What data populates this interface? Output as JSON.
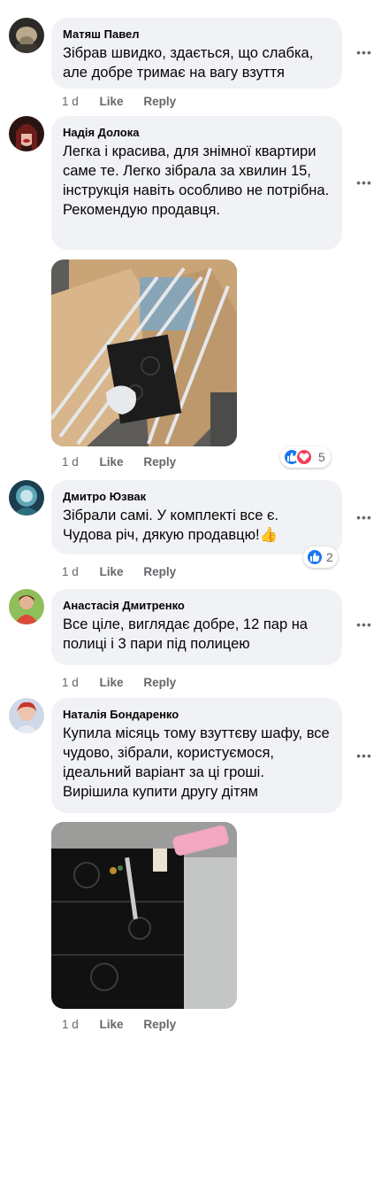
{
  "comments": [
    {
      "name": "Матяш Павел",
      "text": "Зібрав швидко, здається, що слабка, але добре тримає на вагу взуття",
      "time": "1 d",
      "like": "Like",
      "reply": "Reply"
    },
    {
      "name": "Надія Долока",
      "text": "Легка і красива, для знімної квартири саме те. Легко зібрала за хвилин 15, інструкція навіть особливо не потрібна. Рекомендую продавця.",
      "time": "1 d",
      "like": "Like",
      "reply": "Reply",
      "reaction_count": "5"
    },
    {
      "name": "Дмитро Юзвак",
      "text": "Зібрали самі. У комплекті все є. Чудова річ, дякую продавцю!👍",
      "time": "1 d",
      "like": "Like",
      "reply": "Reply",
      "reaction_count": "2"
    },
    {
      "name": "Анастасія Дмитренко",
      "text": "Все ціле, виглядає добре, 12 пар на полиці і 3 пари під полицею",
      "time": "1 d",
      "like": "Like",
      "reply": "Reply"
    },
    {
      "name": "Наталія Бондаренко",
      "text": "Купила місяць тому взуттєву шафу, все чудово, зібрали, користуємося, ідеальний варіант за ці гроші. Вирішила купити другу дітям",
      "time": "1 d",
      "like": "Like",
      "reply": "Reply"
    }
  ],
  "more_glyph": "•••",
  "colors": {
    "bubble": "#f0f2f5",
    "meta": "#65676b",
    "like_blue": "#1877f2",
    "love_red": "#f33e58"
  }
}
